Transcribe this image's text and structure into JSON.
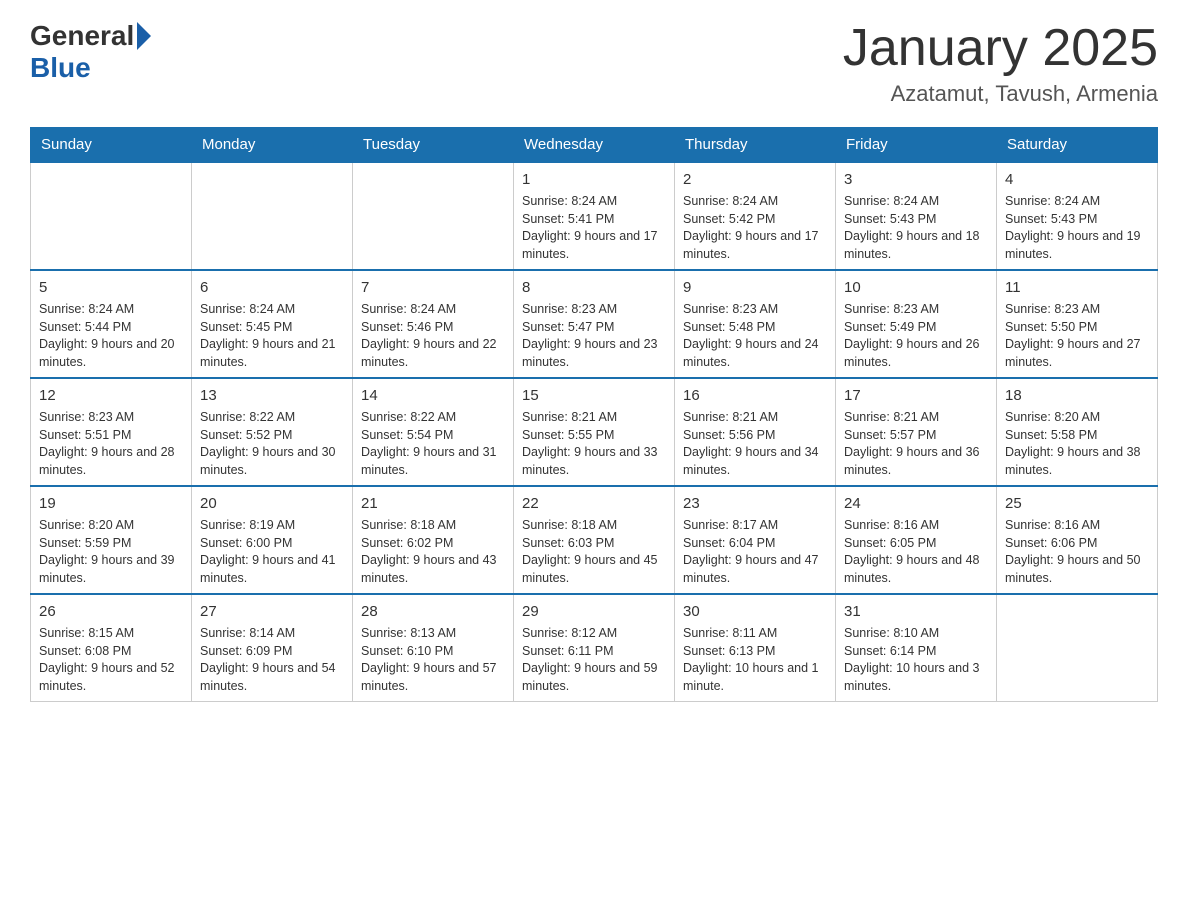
{
  "header": {
    "logo_general": "General",
    "logo_blue": "Blue",
    "title": "January 2025",
    "subtitle": "Azatamut, Tavush, Armenia"
  },
  "days_of_week": [
    "Sunday",
    "Monday",
    "Tuesday",
    "Wednesday",
    "Thursday",
    "Friday",
    "Saturday"
  ],
  "weeks": [
    [
      {
        "day": "",
        "sunrise": "",
        "sunset": "",
        "daylight": ""
      },
      {
        "day": "",
        "sunrise": "",
        "sunset": "",
        "daylight": ""
      },
      {
        "day": "",
        "sunrise": "",
        "sunset": "",
        "daylight": ""
      },
      {
        "day": "1",
        "sunrise": "Sunrise: 8:24 AM",
        "sunset": "Sunset: 5:41 PM",
        "daylight": "Daylight: 9 hours and 17 minutes."
      },
      {
        "day": "2",
        "sunrise": "Sunrise: 8:24 AM",
        "sunset": "Sunset: 5:42 PM",
        "daylight": "Daylight: 9 hours and 17 minutes."
      },
      {
        "day": "3",
        "sunrise": "Sunrise: 8:24 AM",
        "sunset": "Sunset: 5:43 PM",
        "daylight": "Daylight: 9 hours and 18 minutes."
      },
      {
        "day": "4",
        "sunrise": "Sunrise: 8:24 AM",
        "sunset": "Sunset: 5:43 PM",
        "daylight": "Daylight: 9 hours and 19 minutes."
      }
    ],
    [
      {
        "day": "5",
        "sunrise": "Sunrise: 8:24 AM",
        "sunset": "Sunset: 5:44 PM",
        "daylight": "Daylight: 9 hours and 20 minutes."
      },
      {
        "day": "6",
        "sunrise": "Sunrise: 8:24 AM",
        "sunset": "Sunset: 5:45 PM",
        "daylight": "Daylight: 9 hours and 21 minutes."
      },
      {
        "day": "7",
        "sunrise": "Sunrise: 8:24 AM",
        "sunset": "Sunset: 5:46 PM",
        "daylight": "Daylight: 9 hours and 22 minutes."
      },
      {
        "day": "8",
        "sunrise": "Sunrise: 8:23 AM",
        "sunset": "Sunset: 5:47 PM",
        "daylight": "Daylight: 9 hours and 23 minutes."
      },
      {
        "day": "9",
        "sunrise": "Sunrise: 8:23 AM",
        "sunset": "Sunset: 5:48 PM",
        "daylight": "Daylight: 9 hours and 24 minutes."
      },
      {
        "day": "10",
        "sunrise": "Sunrise: 8:23 AM",
        "sunset": "Sunset: 5:49 PM",
        "daylight": "Daylight: 9 hours and 26 minutes."
      },
      {
        "day": "11",
        "sunrise": "Sunrise: 8:23 AM",
        "sunset": "Sunset: 5:50 PM",
        "daylight": "Daylight: 9 hours and 27 minutes."
      }
    ],
    [
      {
        "day": "12",
        "sunrise": "Sunrise: 8:23 AM",
        "sunset": "Sunset: 5:51 PM",
        "daylight": "Daylight: 9 hours and 28 minutes."
      },
      {
        "day": "13",
        "sunrise": "Sunrise: 8:22 AM",
        "sunset": "Sunset: 5:52 PM",
        "daylight": "Daylight: 9 hours and 30 minutes."
      },
      {
        "day": "14",
        "sunrise": "Sunrise: 8:22 AM",
        "sunset": "Sunset: 5:54 PM",
        "daylight": "Daylight: 9 hours and 31 minutes."
      },
      {
        "day": "15",
        "sunrise": "Sunrise: 8:21 AM",
        "sunset": "Sunset: 5:55 PM",
        "daylight": "Daylight: 9 hours and 33 minutes."
      },
      {
        "day": "16",
        "sunrise": "Sunrise: 8:21 AM",
        "sunset": "Sunset: 5:56 PM",
        "daylight": "Daylight: 9 hours and 34 minutes."
      },
      {
        "day": "17",
        "sunrise": "Sunrise: 8:21 AM",
        "sunset": "Sunset: 5:57 PM",
        "daylight": "Daylight: 9 hours and 36 minutes."
      },
      {
        "day": "18",
        "sunrise": "Sunrise: 8:20 AM",
        "sunset": "Sunset: 5:58 PM",
        "daylight": "Daylight: 9 hours and 38 minutes."
      }
    ],
    [
      {
        "day": "19",
        "sunrise": "Sunrise: 8:20 AM",
        "sunset": "Sunset: 5:59 PM",
        "daylight": "Daylight: 9 hours and 39 minutes."
      },
      {
        "day": "20",
        "sunrise": "Sunrise: 8:19 AM",
        "sunset": "Sunset: 6:00 PM",
        "daylight": "Daylight: 9 hours and 41 minutes."
      },
      {
        "day": "21",
        "sunrise": "Sunrise: 8:18 AM",
        "sunset": "Sunset: 6:02 PM",
        "daylight": "Daylight: 9 hours and 43 minutes."
      },
      {
        "day": "22",
        "sunrise": "Sunrise: 8:18 AM",
        "sunset": "Sunset: 6:03 PM",
        "daylight": "Daylight: 9 hours and 45 minutes."
      },
      {
        "day": "23",
        "sunrise": "Sunrise: 8:17 AM",
        "sunset": "Sunset: 6:04 PM",
        "daylight": "Daylight: 9 hours and 47 minutes."
      },
      {
        "day": "24",
        "sunrise": "Sunrise: 8:16 AM",
        "sunset": "Sunset: 6:05 PM",
        "daylight": "Daylight: 9 hours and 48 minutes."
      },
      {
        "day": "25",
        "sunrise": "Sunrise: 8:16 AM",
        "sunset": "Sunset: 6:06 PM",
        "daylight": "Daylight: 9 hours and 50 minutes."
      }
    ],
    [
      {
        "day": "26",
        "sunrise": "Sunrise: 8:15 AM",
        "sunset": "Sunset: 6:08 PM",
        "daylight": "Daylight: 9 hours and 52 minutes."
      },
      {
        "day": "27",
        "sunrise": "Sunrise: 8:14 AM",
        "sunset": "Sunset: 6:09 PM",
        "daylight": "Daylight: 9 hours and 54 minutes."
      },
      {
        "day": "28",
        "sunrise": "Sunrise: 8:13 AM",
        "sunset": "Sunset: 6:10 PM",
        "daylight": "Daylight: 9 hours and 57 minutes."
      },
      {
        "day": "29",
        "sunrise": "Sunrise: 8:12 AM",
        "sunset": "Sunset: 6:11 PM",
        "daylight": "Daylight: 9 hours and 59 minutes."
      },
      {
        "day": "30",
        "sunrise": "Sunrise: 8:11 AM",
        "sunset": "Sunset: 6:13 PM",
        "daylight": "Daylight: 10 hours and 1 minute."
      },
      {
        "day": "31",
        "sunrise": "Sunrise: 8:10 AM",
        "sunset": "Sunset: 6:14 PM",
        "daylight": "Daylight: 10 hours and 3 minutes."
      },
      {
        "day": "",
        "sunrise": "",
        "sunset": "",
        "daylight": ""
      }
    ]
  ]
}
